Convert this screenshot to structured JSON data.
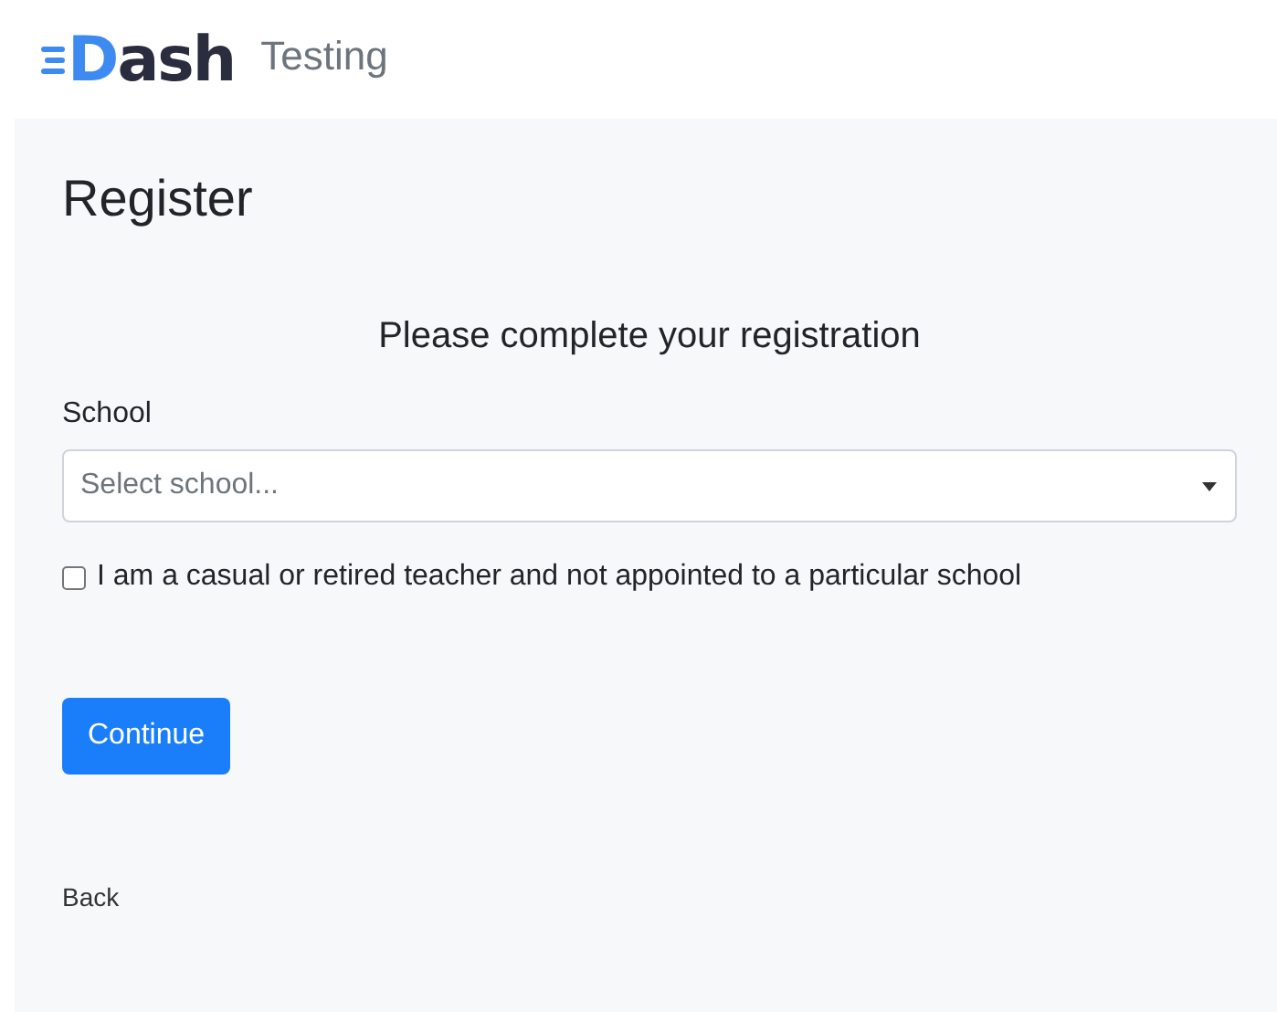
{
  "header": {
    "logo": {
      "accent": "D",
      "rest": "ash"
    },
    "subtitle": "Testing"
  },
  "page": {
    "title": "Register",
    "heading": "Please complete your registration"
  },
  "form": {
    "school_label": "School",
    "school_placeholder": "Select school...",
    "casual_checkbox": {
      "label": "I am a casual or retired teacher and not appointed to a particular school",
      "checked": false
    },
    "continue_button": "Continue"
  },
  "back_link": "Back"
}
